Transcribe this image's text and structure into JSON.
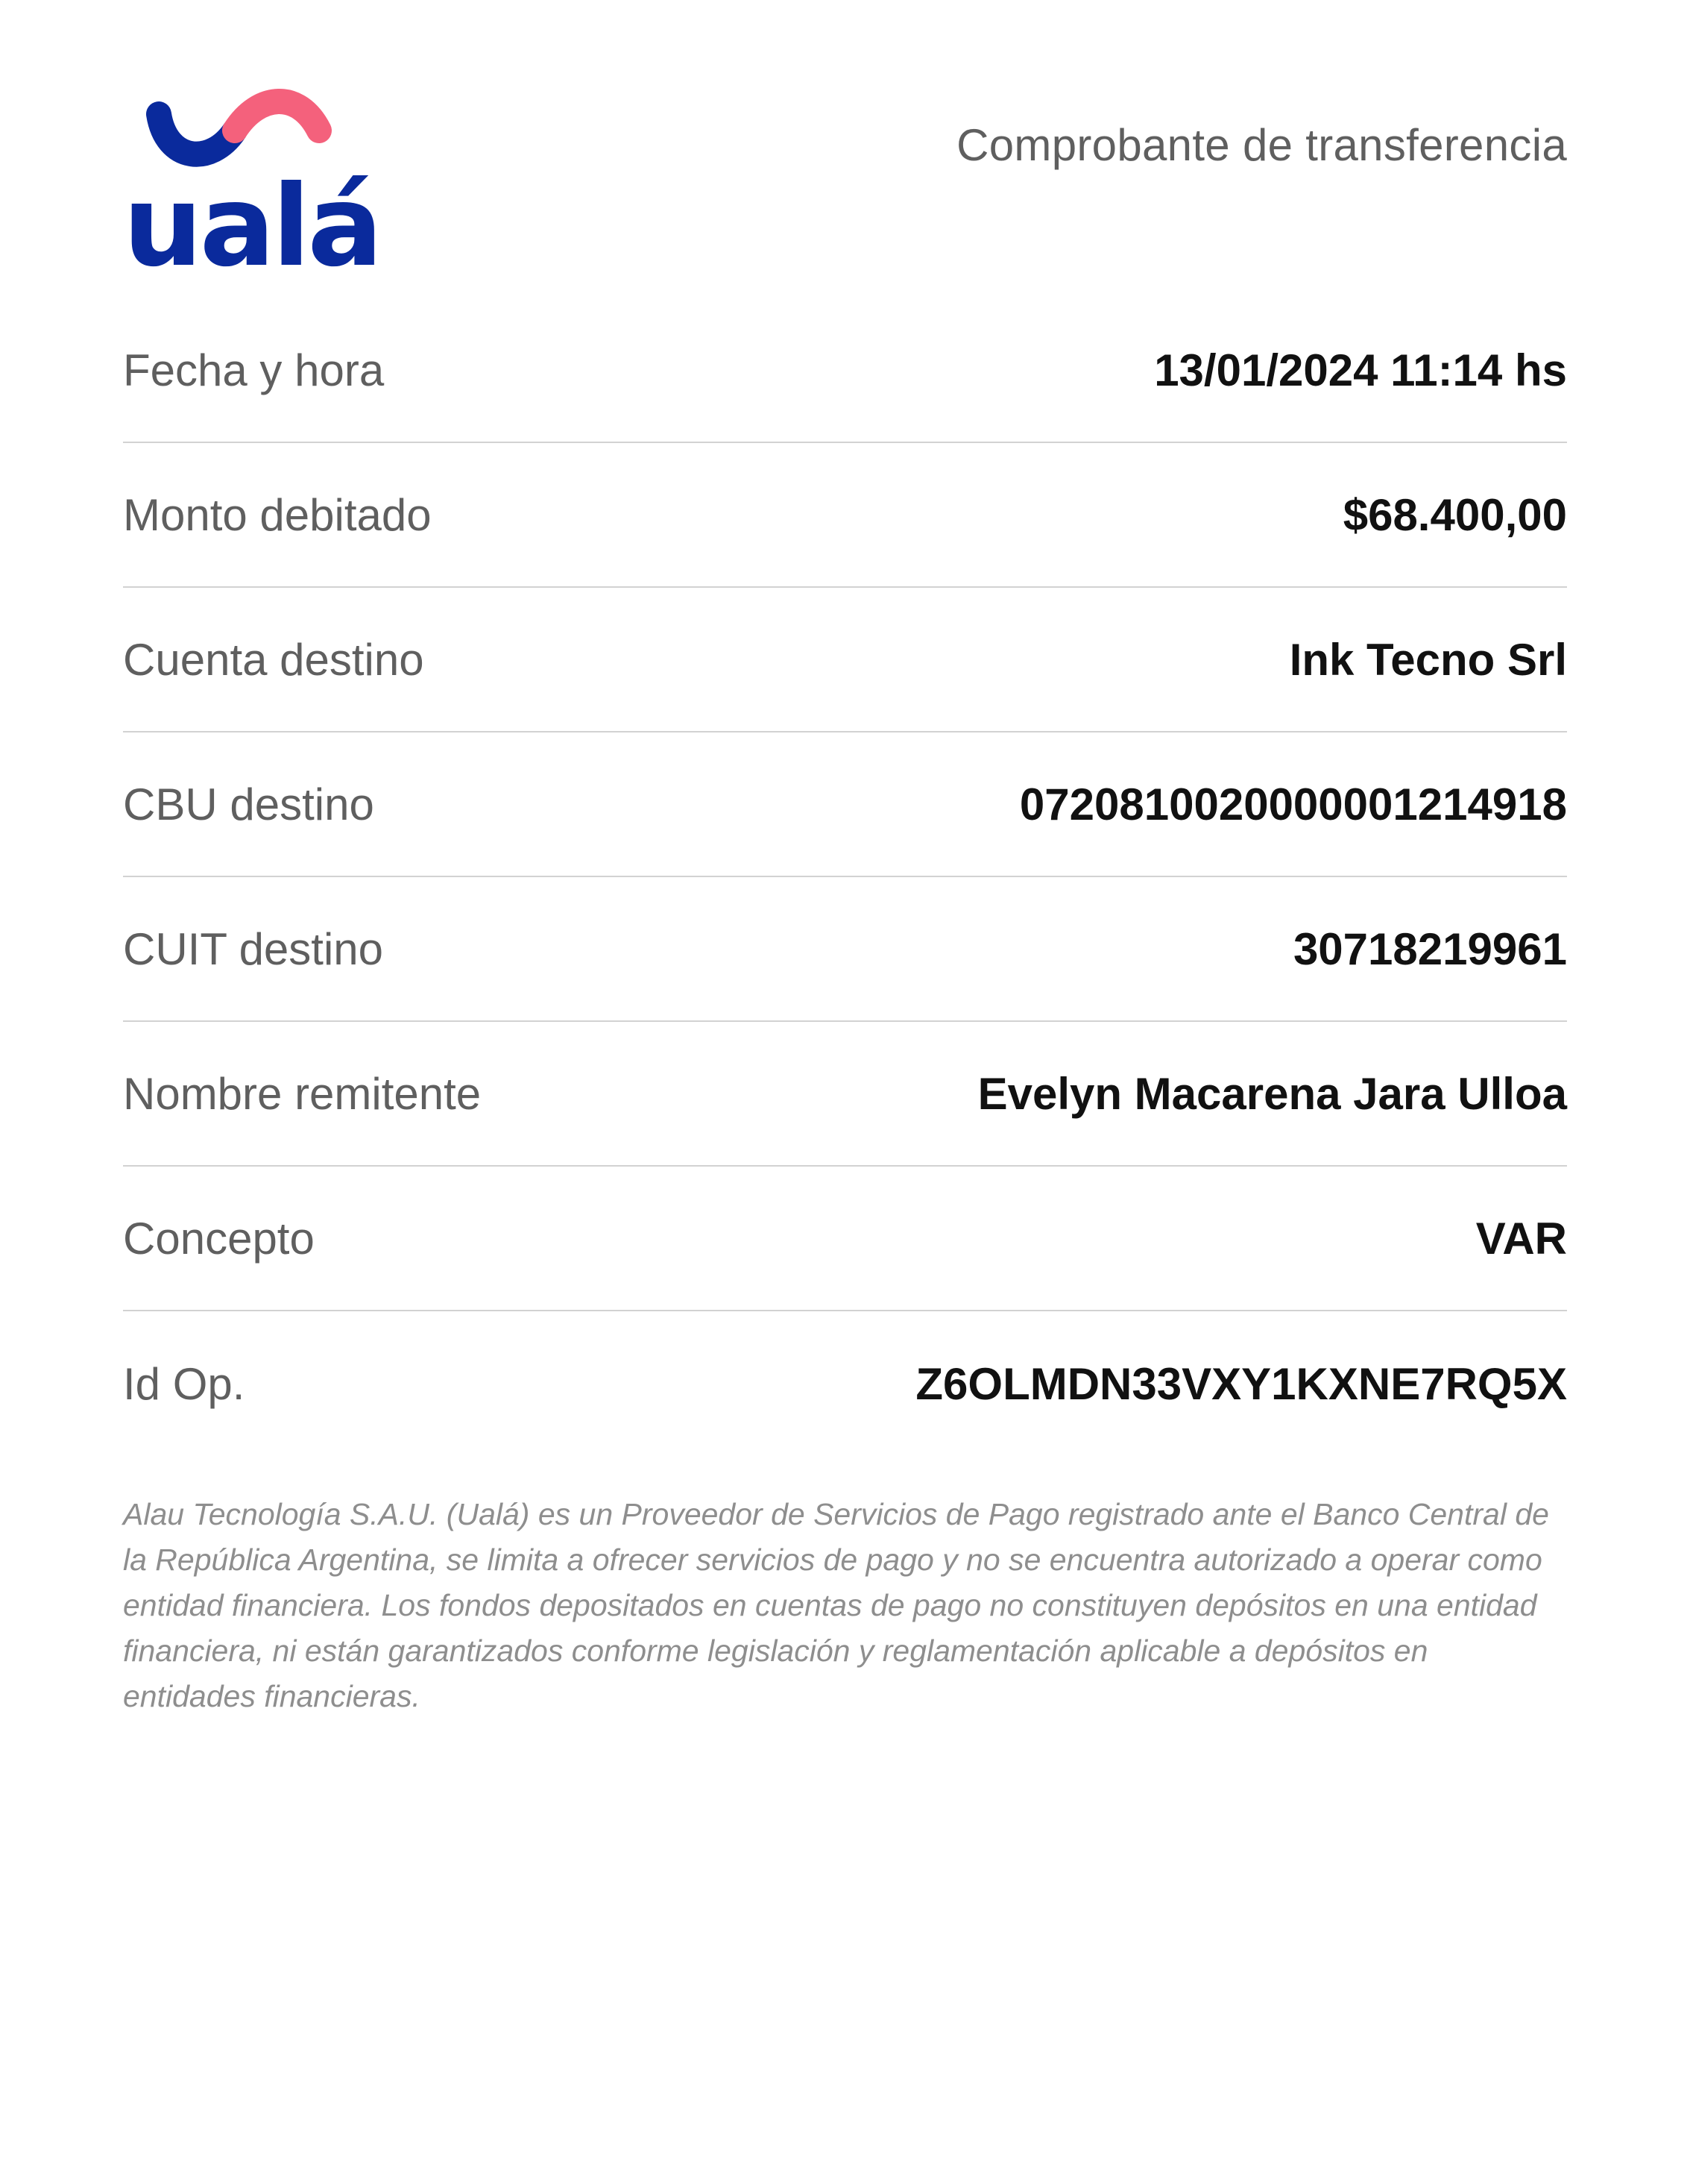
{
  "brand": {
    "logo_text": "ualá",
    "colors": {
      "primary_blue": "#0a2a9c",
      "accent_pink": "#f4617c"
    }
  },
  "header": {
    "title": "Comprobante de transferencia"
  },
  "details": [
    {
      "label": "Fecha y hora",
      "value": "13/01/2024 11:14 hs"
    },
    {
      "label": "Monto debitado",
      "value": "$68.400,00"
    },
    {
      "label": "Cuenta destino",
      "value": "Ink Tecno Srl"
    },
    {
      "label": "CBU destino",
      "value": "0720810020000001214918"
    },
    {
      "label": "CUIT destino",
      "value": "30718219961"
    },
    {
      "label": "Nombre remitente",
      "value": "Evelyn Macarena Jara Ulloa"
    },
    {
      "label": "Concepto",
      "value": "VAR"
    },
    {
      "label": "Id Op.",
      "value": "Z6OLMDN33VXY1KXNE7RQ5X"
    }
  ],
  "footer": {
    "disclaimer": "Alau Tecnología S.A.U. (Ualá) es un Proveedor de Servicios de Pago registrado ante el Banco Central de la República Argentina, se limita a ofrecer servicios de pago y no se encuentra autorizado a operar como entidad financiera. Los fondos depositados en cuentas de pago no constituyen depósitos en una entidad financiera, ni están garantizados conforme legislación y reglamentación aplicable a depósitos en entidades financieras."
  }
}
